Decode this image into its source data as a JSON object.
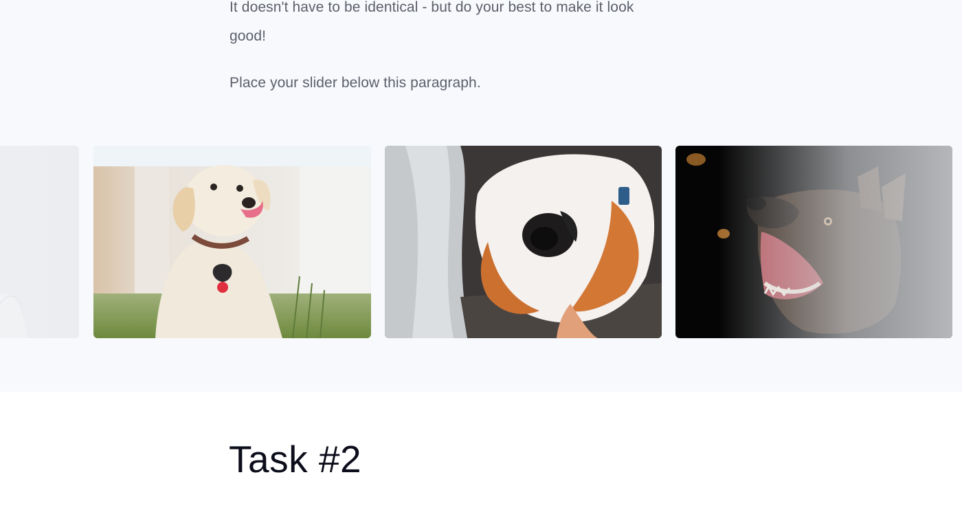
{
  "content": {
    "paragraph_1": "It doesn't have to be identical - but do your best to make it look good!",
    "paragraph_2": "Place your slider below this paragraph."
  },
  "slider": {
    "slides": [
      {
        "subject": "partial white dog image (cut off on left)"
      },
      {
        "subject": "labrador puppy sitting on grass"
      },
      {
        "subject": "fluffy corgi upside down"
      },
      {
        "subject": "german shepherd catching treat"
      }
    ]
  },
  "task": {
    "title": "Task #2"
  },
  "colors": {
    "top_background": "#f7f9fd",
    "bottom_background": "#ffffff",
    "text": "#5c5f68",
    "heading": "#0c0d1a"
  }
}
